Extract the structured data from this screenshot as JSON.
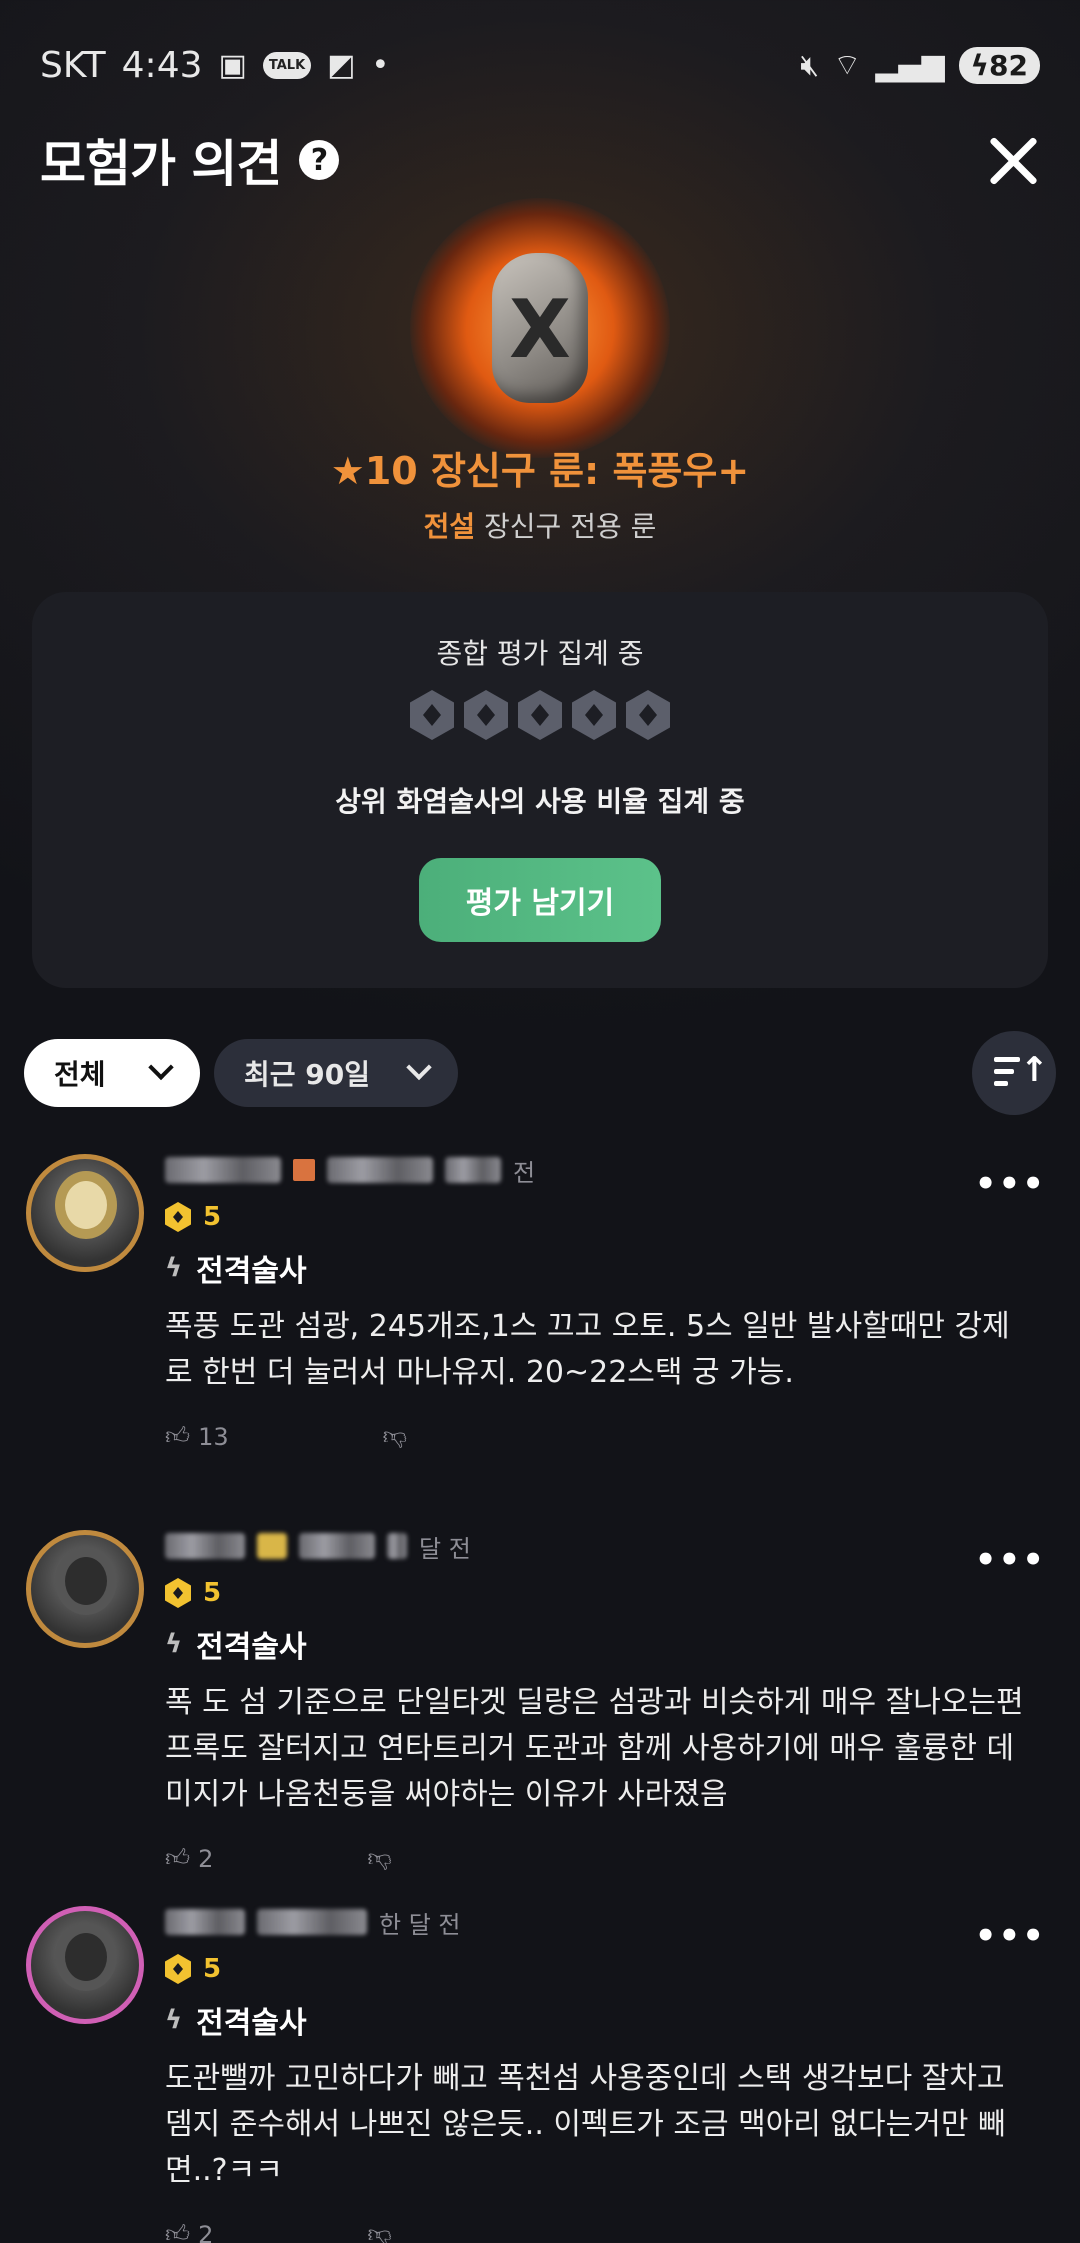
{
  "status_bar": {
    "carrier": "SKT",
    "time": "4:43",
    "talk": "TALK",
    "battery": "82"
  },
  "header": {
    "title": "모험가 의견",
    "help": "?"
  },
  "item": {
    "glyph": "X",
    "name": "★10 장신구 룬: 폭풍우+",
    "rarity": "전설",
    "type": "장신구 전용 룬"
  },
  "summary": {
    "title": "종합 평가 집계 중",
    "desc": "상위 화염술사의 사용 비율 집계 중",
    "button": "평가 남기기"
  },
  "filters": {
    "scope": "전체",
    "period": "최근 90일"
  },
  "reviews": [
    {
      "time": "전",
      "score": "5",
      "class": "전격술사",
      "text": "폭풍 도관 섬광, 245개조,1스 끄고 오토. 5스 일반 발사할때만 강제로 한번 더 눌러서 마나유지. 20~22스택 궁 가능.",
      "likes": "13"
    },
    {
      "time": "달 전",
      "score": "5",
      "class": "전격술사",
      "text": "폭 도 섬 기준으로 단일타겟 딜량은 섬광과 비슷하게 매우 잘나오는편 프록도 잘터지고 연타트리거 도관과 함께 사용하기에 매우 훌륭한 데미지가 나옴천둥을 써야하는 이유가 사라졌음",
      "likes": "2"
    },
    {
      "time": "한 달 전",
      "score": "5",
      "class": "전격술사",
      "text": "도관뺄까 고민하다가 빼고 폭천섬 사용중인데 스택 생각보다 잘차고 뎀지 준수해서 나쁘진 않은듯.. 이펙트가 조금 맥아리 없다는거만 빼면..?ㅋㅋ",
      "likes": "2"
    }
  ]
}
